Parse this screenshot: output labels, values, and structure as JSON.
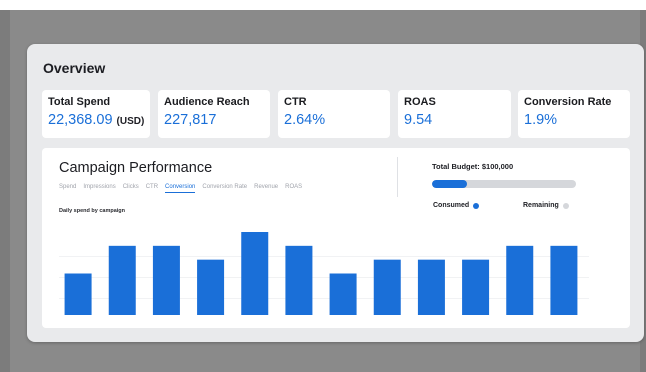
{
  "colors": {
    "accent": "#1a6fd8",
    "remaining": "#d5d7db",
    "grid": "#e3e5e8"
  },
  "overview": {
    "title": "Overview"
  },
  "metrics": [
    {
      "label": "Total Spend",
      "value": "22,368.09",
      "unit": "(USD)"
    },
    {
      "label": "Audience Reach",
      "value": "227,817",
      "unit": ""
    },
    {
      "label": "CTR",
      "value": "2.64%",
      "unit": ""
    },
    {
      "label": "ROAS",
      "value": "9.54",
      "unit": ""
    },
    {
      "label": "Conversion Rate",
      "value": "1.9%",
      "unit": ""
    }
  ],
  "performance": {
    "title": "Campaign Performance",
    "tabs": [
      "Spend",
      "Impressions",
      "Clicks",
      "CTR",
      "Conversion",
      "Conversion Rate",
      "Revenue",
      "ROAS"
    ],
    "active_tab": 4,
    "chart_subtitle": "Daily spend by campaign"
  },
  "budget": {
    "label": "Total Budget: $100,000",
    "consumed_fraction": 0.24,
    "consumed_label": "Consumed",
    "remaining_label": "Remaining"
  },
  "chart_data": {
    "type": "bar",
    "title": "Daily spend by campaign",
    "xlabel": "",
    "ylabel": "",
    "ylim": [
      0,
      6
    ],
    "grid": true,
    "values": [
      3,
      5,
      5,
      4,
      6,
      5,
      3,
      4,
      4,
      4,
      5,
      5
    ]
  }
}
